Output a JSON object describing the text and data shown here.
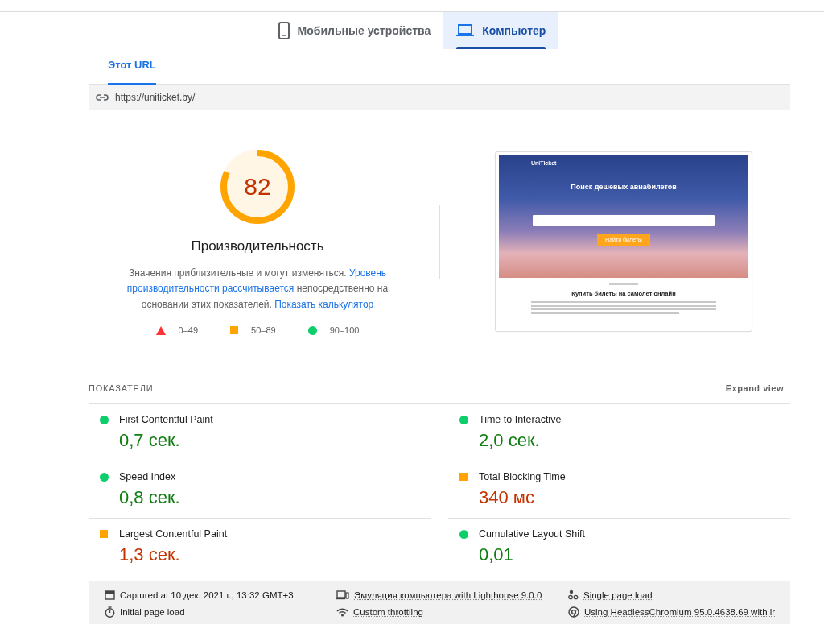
{
  "device_tabs": [
    {
      "label": "Мобильные устройства",
      "kind": "phone",
      "selected": false
    },
    {
      "label": "Компьютер",
      "kind": "laptop",
      "selected": true
    }
  ],
  "url_tabs": [
    {
      "label": "Этот URL",
      "selected": true
    }
  ],
  "url": "https://uniticket.by/",
  "score": {
    "value": "82",
    "level": 0.82,
    "title": "Производительность",
    "description": [
      {
        "text": "Значения приблизительные и могут изменяться. ",
        "link": false
      },
      {
        "text": "Уровень",
        "link": true
      },
      {
        "text": "производительности рассчитывается",
        "link": true
      },
      {
        "text": " непосредственно на основании этих показателей. ",
        "link": false
      },
      {
        "text": "Показать калькулятор",
        "link": true
      }
    ],
    "legend": [
      {
        "kind": "fail",
        "range": "0–49"
      },
      {
        "kind": "average",
        "range": "50–89"
      },
      {
        "kind": "pass",
        "range": "90–100"
      }
    ]
  },
  "preview": {
    "logo": "UniTicket",
    "heading": "Поиск дешевых авиабилетов",
    "button": "Найти билеты",
    "section_title": "Купить билеты на самолёт онлайн"
  },
  "metrics": {
    "title": "ПОКАЗАТЕЛИ",
    "expand": "Expand view",
    "items": [
      {
        "name": "First Contentful Paint",
        "value": "0,7 сек.",
        "kind": "pass"
      },
      {
        "name": "Time to Interactive",
        "value": "2,0 сек.",
        "kind": "pass"
      },
      {
        "name": "Speed Index",
        "value": "0,8 сек.",
        "kind": "pass"
      },
      {
        "name": "Total Blocking Time",
        "value": "340 мс",
        "kind": "average"
      },
      {
        "name": "Largest Contentful Paint",
        "value": "1,3 сек.",
        "kind": "average"
      },
      {
        "name": "Cumulative Layout Shift",
        "value": "0,01",
        "kind": "pass"
      }
    ]
  },
  "footer": [
    {
      "kind": "calendar",
      "text": "Captured at 10 дек. 2021 г., 13:32 GMT+3",
      "link": false
    },
    {
      "kind": "laptop",
      "text": "Эмуляция компьютера with Lighthouse 9.0.0",
      "link": true
    },
    {
      "kind": "dots",
      "text": "Single page load",
      "link": true
    },
    {
      "kind": "timer",
      "text": "Initial page load",
      "link": false
    },
    {
      "kind": "wifi",
      "text": "Custom throttling",
      "link": true
    },
    {
      "kind": "chrome",
      "text": "Using HeadlessChromium 95.0.4638.69 with lr",
      "link": true
    }
  ]
}
